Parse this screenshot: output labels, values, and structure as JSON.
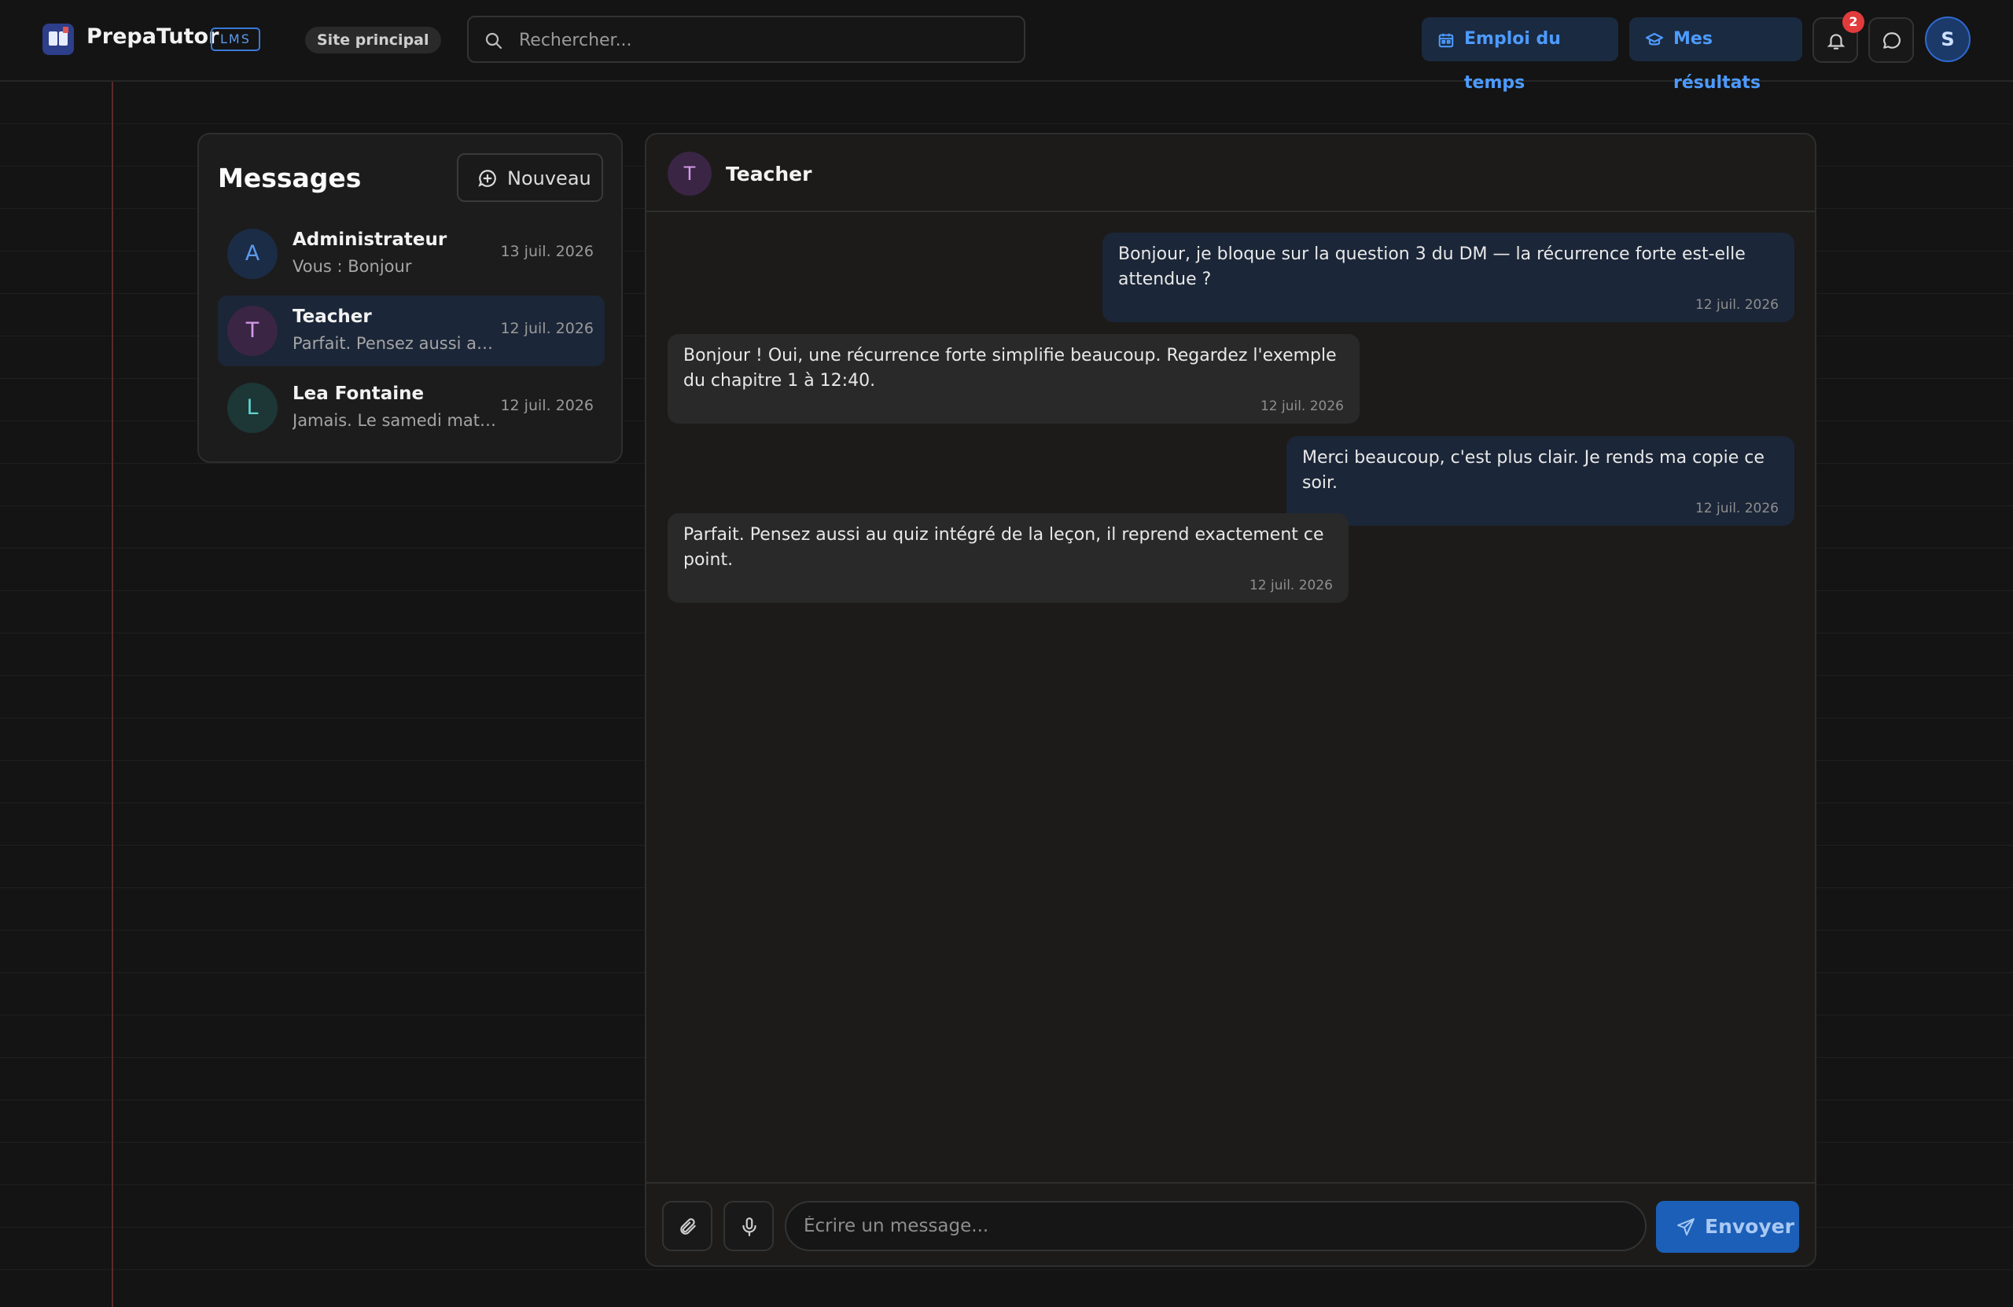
{
  "header": {
    "brand": "PrepaTutor",
    "badge": "LMS",
    "site": "Site principal",
    "search_placeholder": "Rechercher...",
    "schedule_label": "Emploi du temps",
    "results_label": "Mes résultats",
    "notifications_count": "2",
    "user_initial": "S"
  },
  "sidebar": {
    "title": "Messages",
    "new_label": "Nouveau",
    "conversations": [
      {
        "initial": "A",
        "name": "Administrateur",
        "preview": "Vous : Bonjour",
        "date": "13 juil. 2026"
      },
      {
        "initial": "T",
        "name": "Teacher",
        "preview": "Parfait. Pensez aussi au quiz intégré de la leçon, il reprend exactement ce point.",
        "date": "12 juil. 2026"
      },
      {
        "initial": "L",
        "name": "Lea Fontaine",
        "preview": "Jamais. Le samedi matin ...",
        "date": "12 juil. 2026"
      }
    ]
  },
  "chat": {
    "contact_initial": "T",
    "contact_name": "Teacher",
    "messages": [
      {
        "direction": "out",
        "text": "Bonjour, je bloque sur la question 3 du DM — la récurrence forte est-elle attendue ?",
        "time": "12 juil. 2026"
      },
      {
        "direction": "in",
        "text": "Bonjour ! Oui, une récurrence forte simplifie beaucoup. Regardez l'exemple du chapitre 1 à 12:40.",
        "time": "12 juil. 2026"
      },
      {
        "direction": "out",
        "text": "Merci beaucoup, c'est plus clair. Je rends ma copie ce soir.",
        "time": "12 juil. 2026"
      },
      {
        "direction": "in",
        "text": "Parfait. Pensez aussi au quiz intégré de la leçon, il reprend exactement ce point.",
        "time": "12 juil. 2026"
      }
    ],
    "composer_placeholder": "Écrire un message...",
    "send_label": "Envoyer"
  },
  "colors": {
    "accent": "#4d9bff",
    "send": "#1b5fb8",
    "badge": "#e23b3b"
  }
}
